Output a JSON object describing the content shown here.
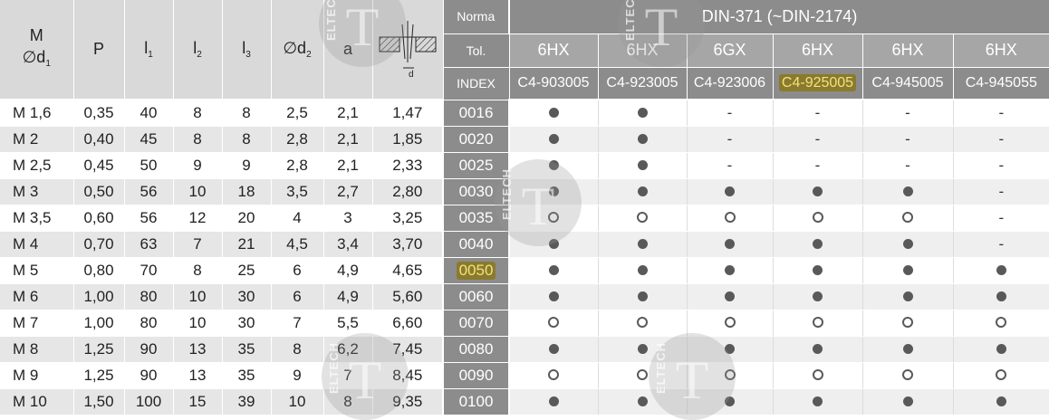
{
  "left_headers": {
    "m": "M",
    "m_sub_symbol": "∅",
    "m_sub_letter": "d",
    "m_sub_index": "1",
    "p": "P",
    "l1_letter": "l",
    "l1_index": "1",
    "l2_letter": "l",
    "l2_index": "2",
    "l3_letter": "l",
    "l3_index": "3",
    "d2_symbol": "∅",
    "d2_letter": "d",
    "d2_index": "2",
    "a": "a",
    "diagram_label": "d"
  },
  "right_headers": {
    "norma_label": "Norma",
    "norma_value": "DIN-371 (~DIN-2174)",
    "tol_label": "Tol.",
    "index_label": "INDEX",
    "tolerances": [
      "6HX",
      "6HX",
      "6GX",
      "6HX",
      "6HX",
      "6HX"
    ],
    "codes": [
      "C4-903005",
      "C4-923005",
      "C4-923006",
      "C4-925005",
      "C4-945005",
      "C4-945055"
    ],
    "highlighted_code": "C4-925005"
  },
  "rows": [
    {
      "m": "M 1,6",
      "p": "0,35",
      "l1": "40",
      "l2": "8",
      "l3": "8",
      "d2": "2,5",
      "a": "2,1",
      "x": "1,47",
      "index": "0016",
      "marks": [
        "filled",
        "filled",
        "dash",
        "dash",
        "dash",
        "dash"
      ]
    },
    {
      "m": "M 2",
      "p": "0,40",
      "l1": "45",
      "l2": "8",
      "l3": "8",
      "d2": "2,8",
      "a": "2,1",
      "x": "1,85",
      "index": "0020",
      "marks": [
        "filled",
        "filled",
        "dash",
        "dash",
        "dash",
        "dash"
      ]
    },
    {
      "m": "M 2,5",
      "p": "0,45",
      "l1": "50",
      "l2": "9",
      "l3": "9",
      "d2": "2,8",
      "a": "2,1",
      "x": "2,33",
      "index": "0025",
      "marks": [
        "filled",
        "filled",
        "dash",
        "dash",
        "dash",
        "dash"
      ]
    },
    {
      "m": "M 3",
      "p": "0,50",
      "l1": "56",
      "l2": "10",
      "l3": "18",
      "d2": "3,5",
      "a": "2,7",
      "x": "2,80",
      "index": "0030",
      "marks": [
        "filled",
        "filled",
        "filled",
        "filled",
        "filled",
        "dash"
      ]
    },
    {
      "m": "M 3,5",
      "p": "0,60",
      "l1": "56",
      "l2": "12",
      "l3": "20",
      "d2": "4",
      "a": "3",
      "x": "3,25",
      "index": "0035",
      "marks": [
        "open",
        "open",
        "open",
        "open",
        "open",
        "dash"
      ]
    },
    {
      "m": "M 4",
      "p": "0,70",
      "l1": "63",
      "l2": "7",
      "l3": "21",
      "d2": "4,5",
      "a": "3,4",
      "x": "3,70",
      "index": "0040",
      "marks": [
        "filled",
        "filled",
        "filled",
        "filled",
        "filled",
        "dash"
      ]
    },
    {
      "m": "M 5",
      "p": "0,80",
      "l1": "70",
      "l2": "8",
      "l3": "25",
      "d2": "6",
      "a": "4,9",
      "x": "4,65",
      "index": "0050",
      "marks": [
        "filled",
        "filled",
        "filled",
        "filled",
        "filled",
        "filled"
      ]
    },
    {
      "m": "M 6",
      "p": "1,00",
      "l1": "80",
      "l2": "10",
      "l3": "30",
      "d2": "6",
      "a": "4,9",
      "x": "5,60",
      "index": "0060",
      "marks": [
        "filled",
        "filled",
        "filled",
        "filled",
        "filled",
        "filled"
      ]
    },
    {
      "m": "M 7",
      "p": "1,00",
      "l1": "80",
      "l2": "10",
      "l3": "30",
      "d2": "7",
      "a": "5,5",
      "x": "6,60",
      "index": "0070",
      "marks": [
        "open",
        "open",
        "open",
        "open",
        "open",
        "open"
      ]
    },
    {
      "m": "M 8",
      "p": "1,25",
      "l1": "90",
      "l2": "13",
      "l3": "35",
      "d2": "8",
      "a": "6,2",
      "x": "7,45",
      "index": "0080",
      "marks": [
        "filled",
        "filled",
        "filled",
        "filled",
        "filled",
        "filled"
      ]
    },
    {
      "m": "M 9",
      "p": "1,25",
      "l1": "90",
      "l2": "13",
      "l3": "35",
      "d2": "9",
      "a": "7",
      "x": "8,45",
      "index": "0090",
      "marks": [
        "open",
        "open",
        "open",
        "open",
        "open",
        "open"
      ]
    },
    {
      "m": "M 10",
      "p": "1,50",
      "l1": "100",
      "l2": "15",
      "l3": "39",
      "d2": "10",
      "a": "8",
      "x": "9,35",
      "index": "0100",
      "marks": [
        "filled",
        "filled",
        "filled",
        "filled",
        "filled",
        "filled"
      ]
    }
  ],
  "highlighted_index": "0050",
  "dash_glyph": "-",
  "watermark": {
    "letter": "T",
    "word": "ELTECH"
  },
  "colors": {
    "header_dark": "#8c8c8c",
    "header_mid": "#a6a6a6",
    "header_light": "#d9d9d9",
    "row_alt": "#e6e6e6",
    "highlight_bg": "#8a7a2e",
    "highlight_text": "#f1e27a",
    "dot": "#595959"
  }
}
